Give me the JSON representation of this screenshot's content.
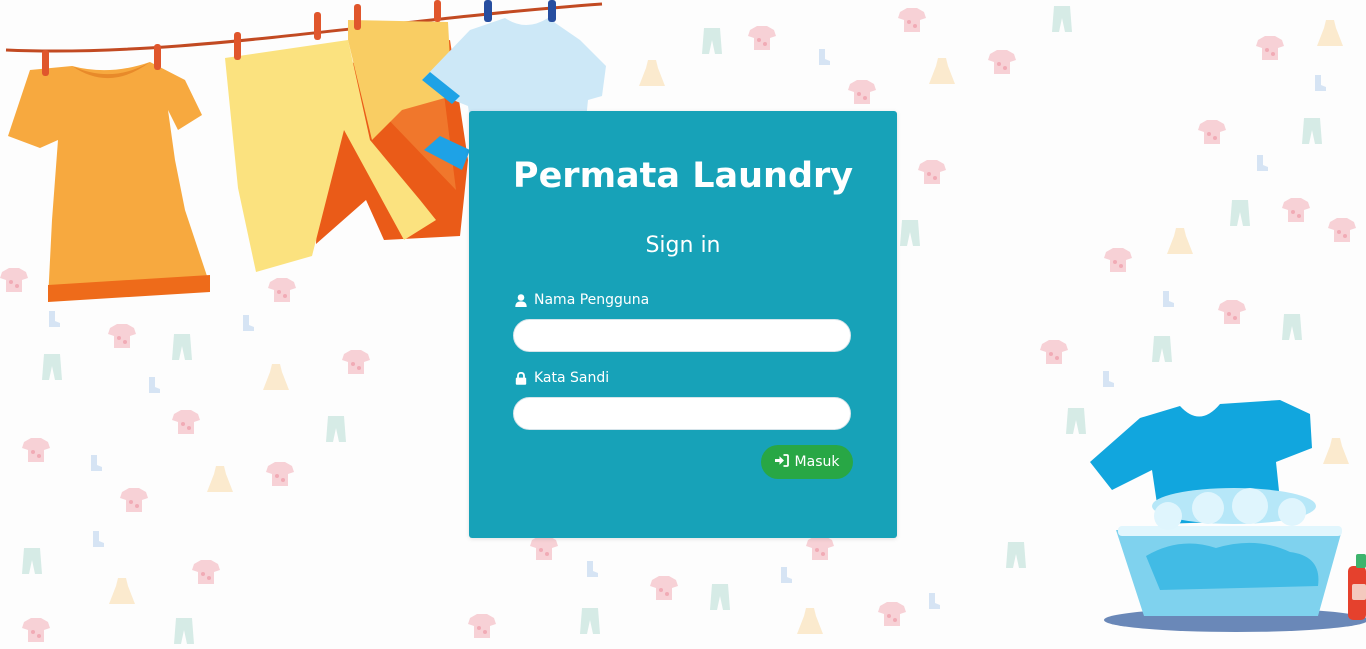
{
  "app": {
    "title": "Permata Laundry",
    "subtitle": "Sign in"
  },
  "form": {
    "username_label": "Nama Pengguna",
    "username_value": "",
    "password_label": "Kata Sandi",
    "password_value": "",
    "submit_label": "Masuk"
  },
  "icons": {
    "username": "user-icon",
    "password": "lock-icon",
    "submit": "sign-in-icon"
  },
  "colors": {
    "card": "#17a2b8",
    "button": "#28a745",
    "text": "#ffffff"
  }
}
